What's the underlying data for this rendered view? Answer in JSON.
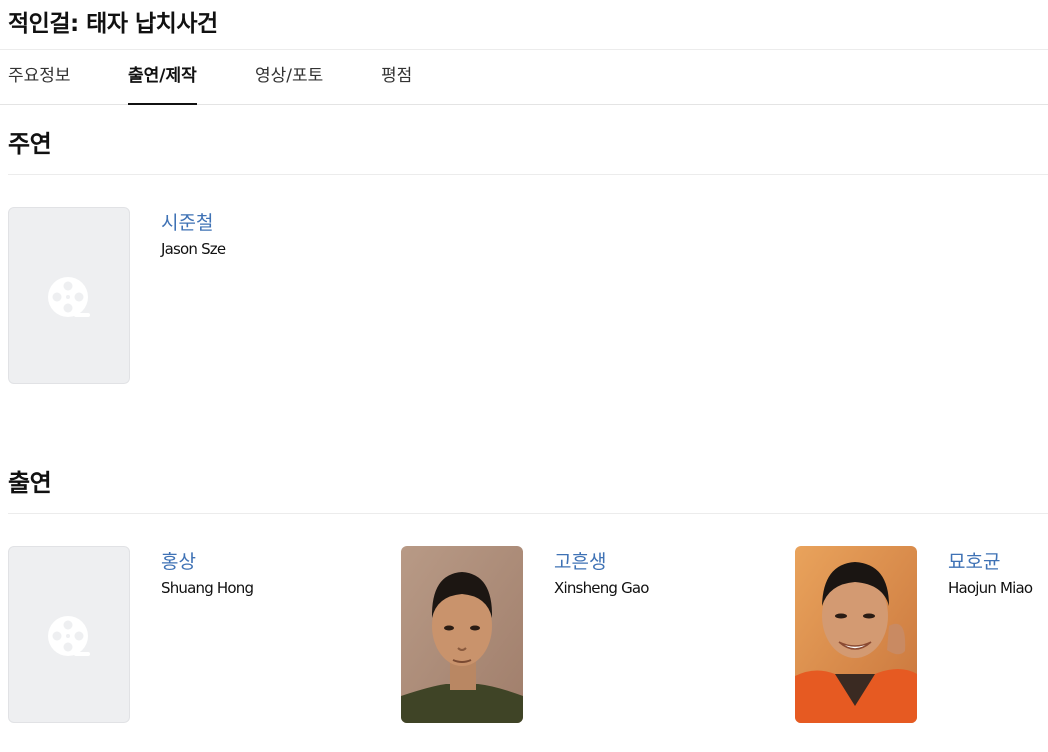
{
  "page_title": "적인걸: 태자 납치사건",
  "tabs": [
    {
      "label": "주요정보"
    },
    {
      "label": "출연/제작"
    },
    {
      "label": "영상/포토"
    },
    {
      "label": "평점"
    }
  ],
  "lead_section": {
    "title": "주연",
    "people": [
      {
        "name_ko": "시준철",
        "name_en": "Jason Sze",
        "photo": "placeholder-film-reel-icon"
      }
    ]
  },
  "cast_section": {
    "title": "출연",
    "people": [
      {
        "name_ko": "홍상",
        "name_en": "Shuang Hong",
        "photo": "placeholder-film-reel-icon"
      },
      {
        "name_ko": "고흔생",
        "name_en": "Xinsheng Gao",
        "photo": "portrait-photo"
      },
      {
        "name_ko": "묘호균",
        "name_en": "Haojun Miao",
        "photo": "portrait-photo"
      }
    ]
  },
  "colors": {
    "name_link": "#3f72b5",
    "placeholder_bg": "#eeeff1",
    "active_tab_underline": "#111111"
  }
}
